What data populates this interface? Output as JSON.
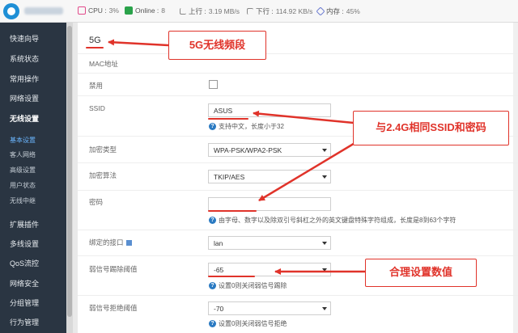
{
  "topbar": {
    "stats": [
      {
        "label": "CPU :",
        "value": "3%",
        "icon": "cpu-icon"
      },
      {
        "label": "Online :",
        "value": "8",
        "icon": "online-icon"
      },
      {
        "label": "上行 :",
        "value": "3.19 MB/s",
        "icon": "upload-icon"
      },
      {
        "label": "下行 :",
        "value": "114.92 KB/s",
        "icon": "download-icon"
      },
      {
        "label": "内存 :",
        "value": "45%",
        "icon": "memory-icon"
      }
    ]
  },
  "sidebar": {
    "items": [
      {
        "label": "快速向导"
      },
      {
        "label": "系统状态"
      },
      {
        "label": "常用操作"
      },
      {
        "label": "网络设置"
      },
      {
        "label": "无线设置"
      },
      {
        "label": "基本设置"
      },
      {
        "label": "客人网络"
      },
      {
        "label": "高级设置"
      },
      {
        "label": "用户状态"
      },
      {
        "label": "无线中继"
      },
      {
        "label": "扩展插件"
      },
      {
        "label": "多线设置"
      },
      {
        "label": "QoS流控"
      },
      {
        "label": "网络安全"
      },
      {
        "label": "分组管理"
      },
      {
        "label": "行为管理"
      }
    ]
  },
  "form": {
    "section_title": "5G",
    "mac_label": "MAC地址",
    "disable_label": "禁用",
    "ssid_label": "SSID",
    "ssid_value": "ASUS",
    "ssid_hint": "支持中文，长度小于32",
    "encrypt_type_label": "加密类型",
    "encrypt_type_value": "WPA-PSK/WPA2-PSK",
    "encrypt_algo_label": "加密算法",
    "encrypt_algo_value": "TKIP/AES",
    "password_label": "密码",
    "password_value": "",
    "password_hint": "由字母、数字以及除双引号斜杠之外的英文键盘特殊字符组成，长度是8到63个字符",
    "bind_iface_label": "绑定的接口",
    "bind_iface_value": "lan",
    "weak_kick_label": "弱信号踢除阈值",
    "weak_kick_value": "-65",
    "weak_kick_hint": "设置0则关闭弱信号踢除",
    "weak_reject_label": "弱信号拒绝阈值",
    "weak_reject_value": "-70",
    "weak_reject_hint": "设置0则关闭弱信号拒绝"
  },
  "annotations": {
    "callout_5g": "5G无线频段",
    "callout_same": "与2.4G相同SSID和密码",
    "callout_threshold": "合理设置数值",
    "color": "#e0332a"
  },
  "colors": {
    "sidebar_bg": "#2a3542",
    "accent": "#1e8fd6",
    "annotation_red": "#e0332a"
  }
}
